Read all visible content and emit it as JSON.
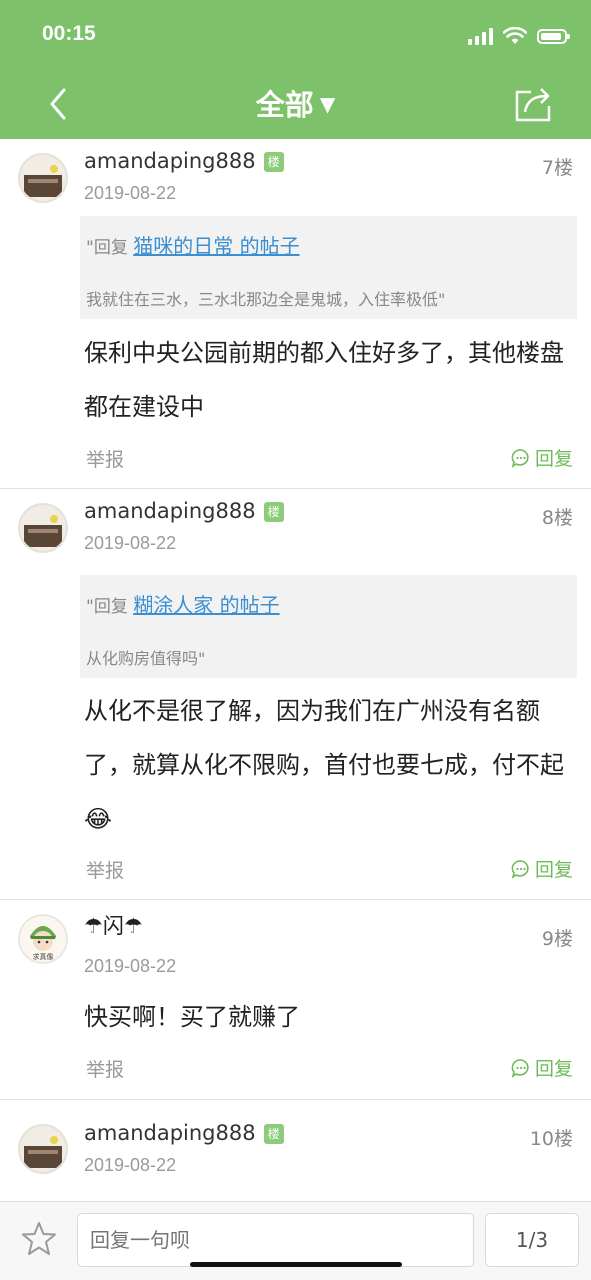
{
  "status_bar": {
    "time": "00:15"
  },
  "header": {
    "title": "全部",
    "title_arrow": "▼"
  },
  "posts": [
    {
      "username": "amandaping888",
      "badge": "楼",
      "date": "2019-08-22",
      "floor": "7楼",
      "quote_prefix": "\"回复",
      "quote_link": "猫咪的日常 的帖子",
      "quote_text": "我就住在三水，三水北那边全是鬼城，入住率极低\"",
      "content": "保利中央公园前期的都入住好多了，其他楼盘都在建设中",
      "report": "举报",
      "reply": "回复"
    },
    {
      "username": "amandaping888",
      "badge": "楼",
      "date": "2019-08-22",
      "floor": "8楼",
      "quote_prefix": "\"回复",
      "quote_link": "糊涂人家 的帖子",
      "quote_text": "从化购房值得吗\"",
      "content": "从化不是很了解，因为我们在广州没有名额了，就算从化不限购，首付也要七成，付不起😂",
      "report": "举报",
      "reply": "回复"
    },
    {
      "username": "☂闪☂",
      "date": "2019-08-22",
      "floor": "9楼",
      "avatar_caption": "求真像",
      "content": "快买啊！买了就赚了",
      "report": "举报",
      "reply": "回复"
    },
    {
      "username": "amandaping888",
      "badge": "楼",
      "date": "2019-08-22",
      "floor": "10楼"
    }
  ],
  "bottom_bar": {
    "reply_placeholder": "回复一句呗",
    "page_indicator": "1/3"
  },
  "colors": {
    "header_green": "#7dc16a",
    "link_blue": "#3b8fd1",
    "reply_green": "#6fbb57",
    "quote_bg": "#f2f2f2"
  }
}
